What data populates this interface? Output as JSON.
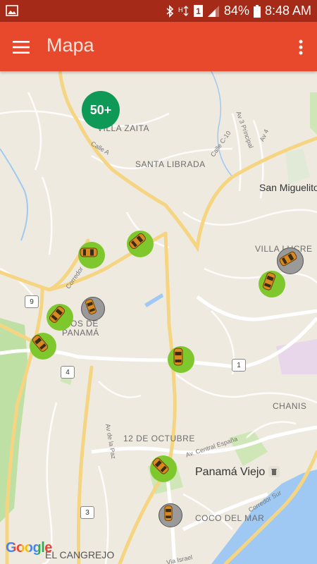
{
  "status_bar": {
    "battery": "84%",
    "time": "8:48 AM",
    "sim_badge": "1",
    "color": "#a52a17"
  },
  "app_bar": {
    "title": "Mapa",
    "color": "#e8492c"
  },
  "map": {
    "cluster_label": "50+",
    "labels": {
      "villa_zaita": "VILLA ZAITA",
      "santa_librada": "SANTA LIBRADA",
      "san_miguelito": "San Miguelito",
      "villa_lucre": "VILLA LUCRE",
      "los_de": "OS DE",
      "panama": "PANAMÁ",
      "chanis": "CHANIS",
      "doce_octubre": "12 DE OCTUBRE",
      "panama_viejo": "Panamá Viejo",
      "coco_del_mar": "COCO DEL MAR",
      "el_cangrejo": "EL CANGREJO"
    },
    "road_labels": {
      "calle_a": "Calle A",
      "calle_c10": "Calle C-10",
      "av3_principal": "Av 3 Principal",
      "av4": "Av 4",
      "corredor": "Corredor",
      "av_de_la_paz": "Av de la Paz",
      "av_central_espana": "Av. Central España",
      "corredor_sur": "Corredor Sur",
      "via_israel": "Via Israel"
    },
    "shields": {
      "r9": "9",
      "r4": "4",
      "r1": "1",
      "r3": "3"
    },
    "attribution": "Google",
    "colors": {
      "land": "#efeae0",
      "road": "#ffffff",
      "highway": "#f5d581",
      "park": "#bfe0a4",
      "water": "#9fc9f3",
      "taxi_available": "#7ec82e",
      "taxi_busy": "#9a9a9a",
      "cluster": "#0e9a56"
    }
  }
}
